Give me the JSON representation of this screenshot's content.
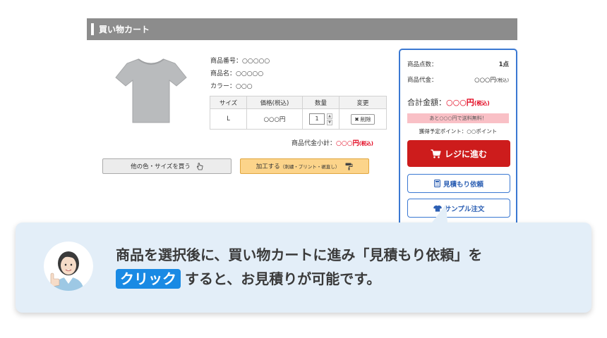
{
  "header": {
    "title": "買い物カート"
  },
  "product": {
    "number": "商品番号：○○○○○",
    "name": "商品名：○○○○○",
    "color": "カラー：○○○"
  },
  "table": {
    "headers": [
      "サイズ",
      "価格(税込)",
      "数量",
      "変更"
    ],
    "row": {
      "size": "L",
      "price": "○○○円",
      "qty": "1",
      "delete": "削除"
    }
  },
  "subtotal": {
    "label": "商品代金小計：",
    "amount": "○○○円",
    "tax": "(税込)"
  },
  "buttons": {
    "other": "他の色・サイズを買う",
    "process": "加工する",
    "process_sub": "（刺繍・プリント・裾直し）"
  },
  "summary": {
    "count_label": "商品点数：",
    "count_value": "1点",
    "price_label": "商品代金：",
    "price_value": "○○○円",
    "price_tax": "(税込)",
    "total_label": "合計金額：",
    "total_value": "○○○円",
    "total_tax": "(税込)",
    "free_shipping": "あと○○○円で送料無料！",
    "points": "獲得予定ポイント：○○ポイント",
    "checkout": "レジに進む",
    "estimate": "見積もり依頼",
    "sample": "サンプル注文"
  },
  "callout": {
    "line1": "商品を選択後に、買い物カートに進み「見積もり依頼」を",
    "click": "クリック",
    "line2": "すると、お見積りが可能です。"
  },
  "colors": {
    "accent_blue": "#3a78d2",
    "checkout_red": "#cd1c1c",
    "price_red": "#e2001a",
    "click_badge": "#1a8ae4",
    "callout_bg": "#e3eef8"
  },
  "icons": [
    "cart-icon",
    "calculator-icon",
    "tshirt-icon",
    "pointer-hand-icon",
    "paint-roller-icon",
    "close-icon"
  ]
}
